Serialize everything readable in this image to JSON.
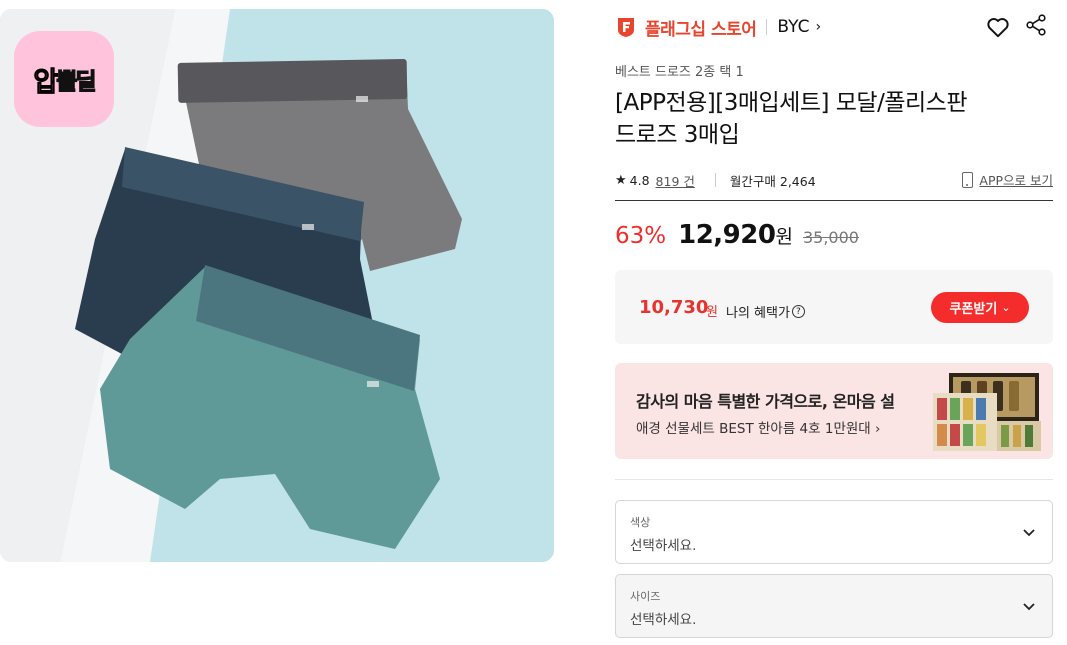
{
  "badge": {
    "pink": "압",
    "black": "뽈딜"
  },
  "store": {
    "name": "플래그십 스토어",
    "brand": "BYC",
    "brand_chevron": "›"
  },
  "product": {
    "category": "베스트 드로즈 2종 택 1",
    "title_line1": "[APP전용][3매입세트] 모달/폴리스판",
    "title_line2": "드로즈 3매입",
    "rating": "4.8",
    "reviews": "819 건",
    "monthly": "월간구매 2,464",
    "app_view": "APP으로 보기",
    "star_icon": "★"
  },
  "price": {
    "discount": "63%",
    "sale": "12,920",
    "won": "원",
    "original": "35,000"
  },
  "benefit": {
    "price": "10,730",
    "won": "원",
    "label": "나의 혜택가",
    "help": "?",
    "coupon_label": "쿠폰받기",
    "coupon_chevron": "⌄"
  },
  "promo": {
    "title": "감사의 마음 특별한 가격으로, 온마음 설",
    "subtitle": "애경 선물세트 BEST 한아름 4호 1만원대 ›"
  },
  "options": [
    {
      "label": "색상",
      "value": "선택하세요."
    },
    {
      "label": "사이즈",
      "value": "선택하세요."
    }
  ],
  "colors": {
    "accent": "#f02c2c",
    "store": "#e8452e",
    "banner_bg": "#fbe4e4",
    "benefit_bg": "#f6f6f6"
  },
  "icons": [
    "heart-icon",
    "share-icon",
    "store-logo-icon",
    "phone-icon",
    "help-icon",
    "chevron-down-icon"
  ]
}
